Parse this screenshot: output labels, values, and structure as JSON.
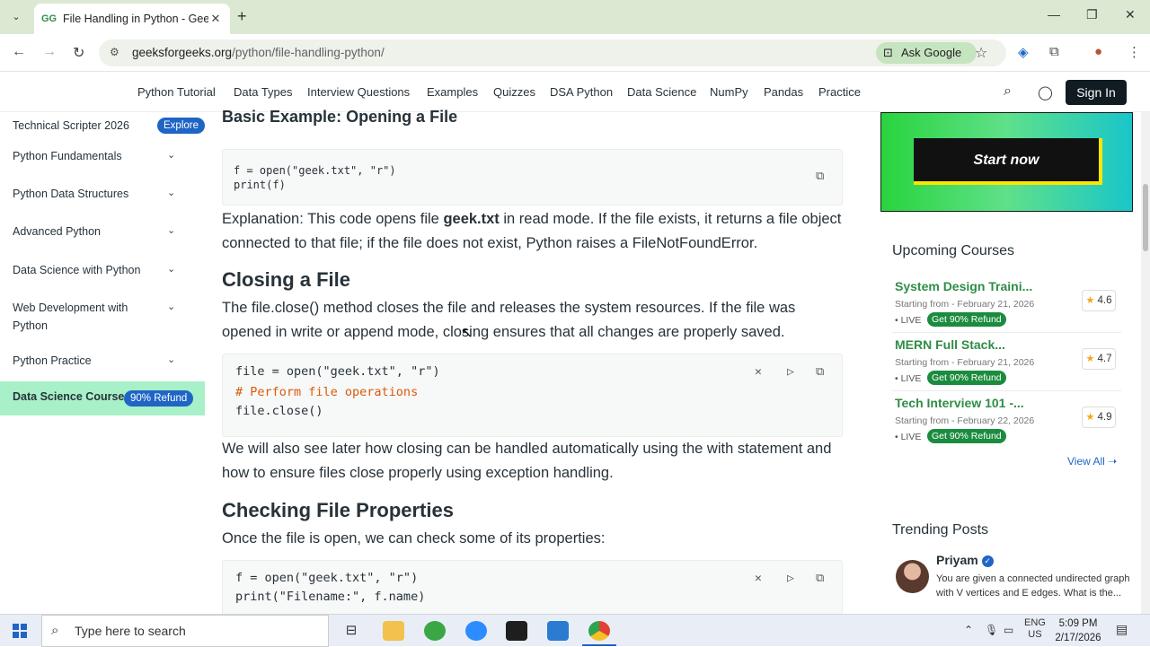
{
  "browser": {
    "tab_title": "File Handling in Python - Geeks",
    "url_host": "geeksforgeeks.org",
    "url_path": "/python/file-handling-python/",
    "ask_google": "Ask Google"
  },
  "sitenav": {
    "links": [
      "Python Tutorial",
      "Data Types",
      "Interview Questions",
      "Examples",
      "Quizzes",
      "DSA Python",
      "Data Science",
      "NumPy",
      "Pandas",
      "Practice"
    ],
    "signin": "Sign In"
  },
  "sidebar": {
    "top_item": "Technical Scripter 2026",
    "top_pill": "Explore",
    "items": [
      "Python Fundamentals",
      "Python Data Structures",
      "Advanced Python",
      "Data Science with Python",
      "Web Development with Python",
      "Python Practice"
    ],
    "active_item": "Data Science Course",
    "active_pill": "90% Refund"
  },
  "main": {
    "heading_basic": "Basic Example: Opening a File",
    "code1": [
      "f = open(\"geek.txt\", \"r\")",
      "print(f)"
    ],
    "para1_a": "Explanation: This code opens file ",
    "para1_bold": "geek.txt",
    "para1_b": " in read mode. If the file exists, it returns a file object connected to that file; if the file does not exist, Python raises a FileNotFoundError.",
    "heading_closing": "Closing a File",
    "para2": "The file.close() method closes the file and releases the system resources. If the file was opened in write or append mode, closing ensures that all changes are properly saved.",
    "code2": {
      "line1": "file = open(\"geek.txt\", \"r\")",
      "comment": "# Perform file operations",
      "line3": "file.close()"
    },
    "para3": "We will also see later how closing can be handled automatically using the with statement and how to ensure files close properly using exception handling.",
    "heading_props": "Checking File Properties",
    "para4": "Once the file is open, we can check some of its properties:",
    "code3": [
      "f = open(\"geek.txt\", \"r\")",
      "print(\"Filename:\", f.name)"
    ]
  },
  "ad": {
    "button": "Start now"
  },
  "upcoming": {
    "title": "Upcoming Courses",
    "courses": [
      {
        "name": "System Design Traini...",
        "date": "Starting from - February 21, 2026",
        "live": "• LIVE",
        "refund": "Get 90% Refund",
        "rating": "4.6"
      },
      {
        "name": "MERN Full Stack...",
        "date": "Starting from - February 21, 2026",
        "live": "• LIVE",
        "refund": "Get 90% Refund",
        "rating": "4.7"
      },
      {
        "name": "Tech Interview 101 -...",
        "date": "Starting from - February 22, 2026",
        "live": "• LIVE",
        "refund": "Get 90% Refund",
        "rating": "4.9"
      }
    ],
    "view_all": "View All"
  },
  "trending": {
    "title": "Trending Posts",
    "author": "Priyam",
    "text": "You are given a connected undirected graph with V vertices and E edges. What is the..."
  },
  "taskbar": {
    "search_placeholder": "Type here to search",
    "lang": "ENG",
    "region": "US",
    "time": "5:09 PM",
    "date": "2/17/2026"
  },
  "colors": {
    "accent": "#2f8d46",
    "blue": "#1f65c5",
    "active_bg": "#a8f0c8"
  }
}
